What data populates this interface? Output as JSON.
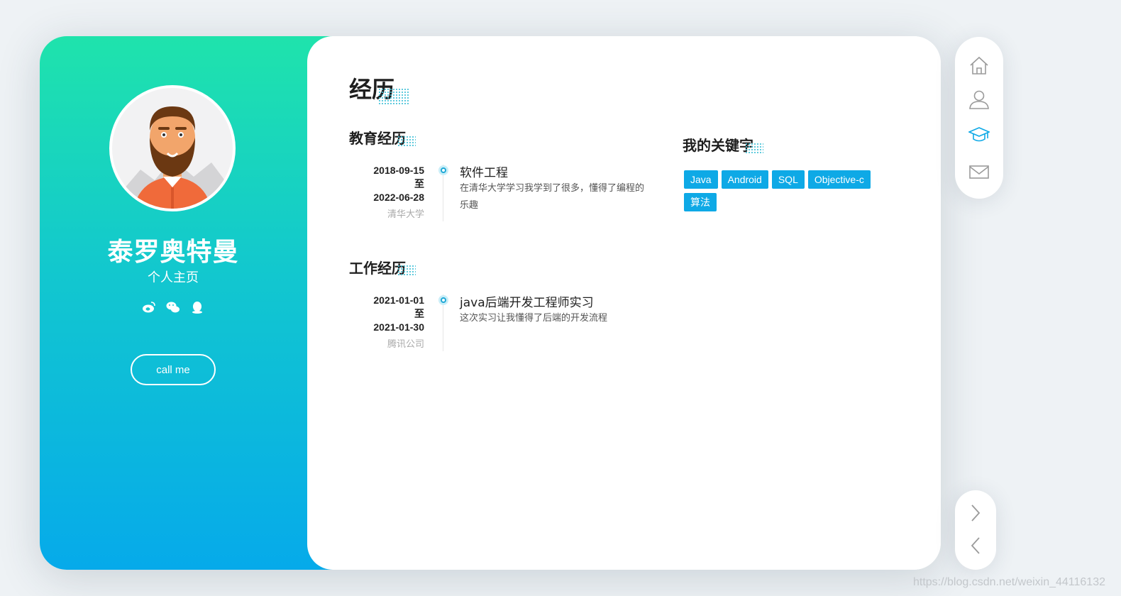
{
  "profile": {
    "name": "泰罗奥特曼",
    "subtitle": "个人主页",
    "call_label": "call me",
    "social_icons": [
      "weibo-icon",
      "wechat-icon",
      "qq-icon"
    ]
  },
  "section": {
    "title": "经历"
  },
  "education": {
    "heading": "教育经历",
    "items": [
      {
        "date_start": "2018-09-15",
        "date_sep": "至",
        "date_end": "2022-06-28",
        "place": "清华大学",
        "title": "软件工程",
        "description": "在清华大学学习我学到了很多，懂得了编程的乐趣"
      }
    ]
  },
  "work": {
    "heading": "工作经历",
    "items": [
      {
        "date_start": "2021-01-01",
        "date_sep": "至",
        "date_end": "2021-01-30",
        "place": "腾讯公司",
        "title": "java后端开发工程师实习",
        "description": "这次实习让我懂得了后端的开发流程"
      }
    ]
  },
  "keywords": {
    "heading": "我的关键字",
    "tags": [
      "Java",
      "Android",
      "SQL",
      "Objective-c",
      "算法"
    ]
  },
  "nav": {
    "items": [
      "home-icon",
      "user-icon",
      "graduation-cap-icon",
      "mail-icon"
    ],
    "active": "graduation-cap-icon"
  },
  "pager": [
    "chevron-right-icon",
    "chevron-left-icon"
  ],
  "watermark": "https://blog.csdn.net/weixin_44116132",
  "colors": {
    "gradient_top": "#1fe3ac",
    "gradient_bottom": "#06aaea",
    "accent": "#0ea9e6"
  }
}
